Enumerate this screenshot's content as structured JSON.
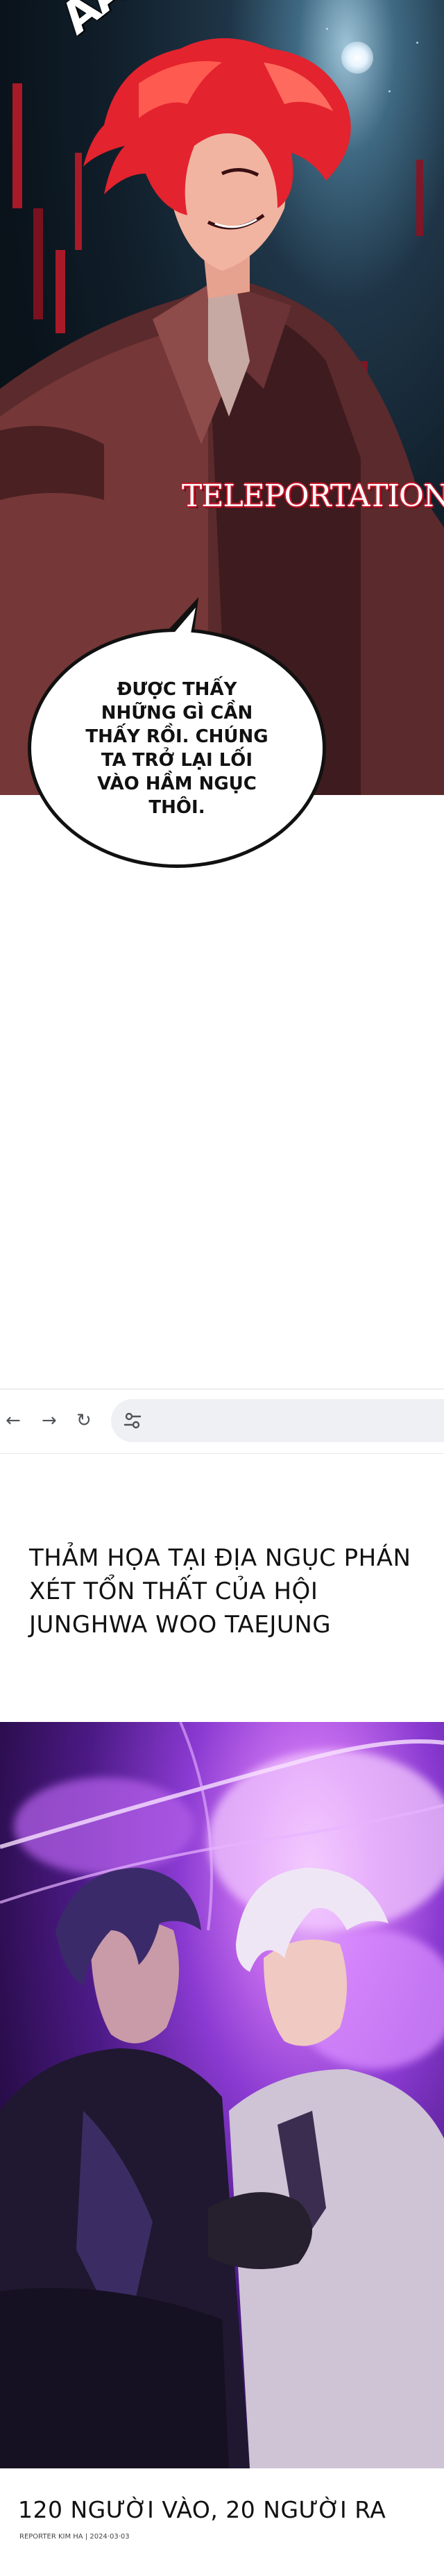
{
  "panel1": {
    "sfx_text": "ẢẢK",
    "title_text": "TELEPORTATION",
    "speech_bubble": "ĐƯỢC THẤY NHỮNG GÌ CẦN THẤY RỒI. CHÚNG TA TRỞ LẠI LỐI VÀO HẦM NGỤC THÔI."
  },
  "browser": {
    "back_icon": "←",
    "forward_icon": "→",
    "reload_icon": "↻",
    "site_info_icon": "tune-icon"
  },
  "caption1": "THẢM HỌA TẠI ĐỊA NGỤC PHÁN XÉT TỔN THẤT CỦA HỘI JUNGHWA WOO TAEJUNG",
  "caption2": "120 NGƯỜI VÀO, 20 NGƯỜI RA",
  "credit": "REPORTER KIM HA | 2024·03·03",
  "colors": {
    "accent_red": "#c41b2a",
    "purple": "#8a3ad1"
  }
}
